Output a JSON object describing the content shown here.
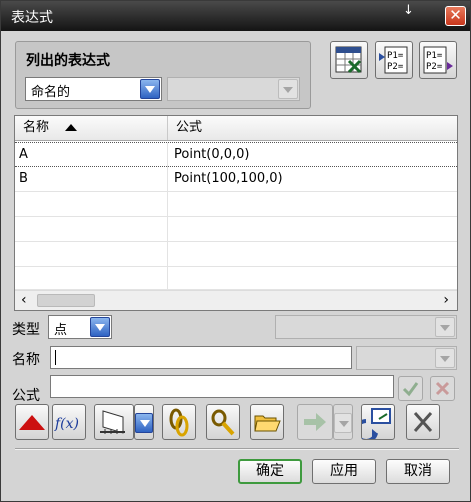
{
  "window": {
    "title": "表达式",
    "pin_glyph": "↓",
    "close_glyph": "✕"
  },
  "list_group": {
    "title": "列出的表达式",
    "filter": {
      "selected": "命名的"
    },
    "secondary": {
      "selected": ""
    },
    "toolbar_icons": [
      "spreadsheet-edit-icon",
      "import-params-icon",
      "export-params-icon"
    ],
    "import_icon_text": [
      "P1=",
      "P2="
    ],
    "export_icon_text": [
      "P1=",
      "P2="
    ]
  },
  "table": {
    "columns": [
      "名称",
      "公式"
    ],
    "sort_column": "名称",
    "sort_direction": "ascending",
    "rows": [
      {
        "name": "A",
        "formula": "Point(0,0,0)"
      },
      {
        "name": "B",
        "formula": "Point(100,100,0)"
      }
    ],
    "scroll_left": "‹",
    "scroll_right": "›"
  },
  "form": {
    "type_label": "类型",
    "type_value": "点",
    "name_label": "名称",
    "name_value": "",
    "formula_label": "公式",
    "formula_value": ""
  },
  "tool_icons": [
    "red-triangle-icon",
    "function-fx-icon",
    "measure-dropdown-icon",
    "link-expression-icon",
    "link-part-icon",
    "open-folder-icon",
    "apply-arrow-icon",
    "refresh-icon",
    "delete-icon"
  ],
  "function_icon_text": "f(x)",
  "buttons": {
    "ok": "确定",
    "apply": "应用",
    "cancel": "取消"
  },
  "colors": {
    "title_bar": "#1e1e1e",
    "close_button": "#d9502f",
    "ok_border": "#3e9a3e",
    "dropdown_blue": "#2f63c2"
  }
}
